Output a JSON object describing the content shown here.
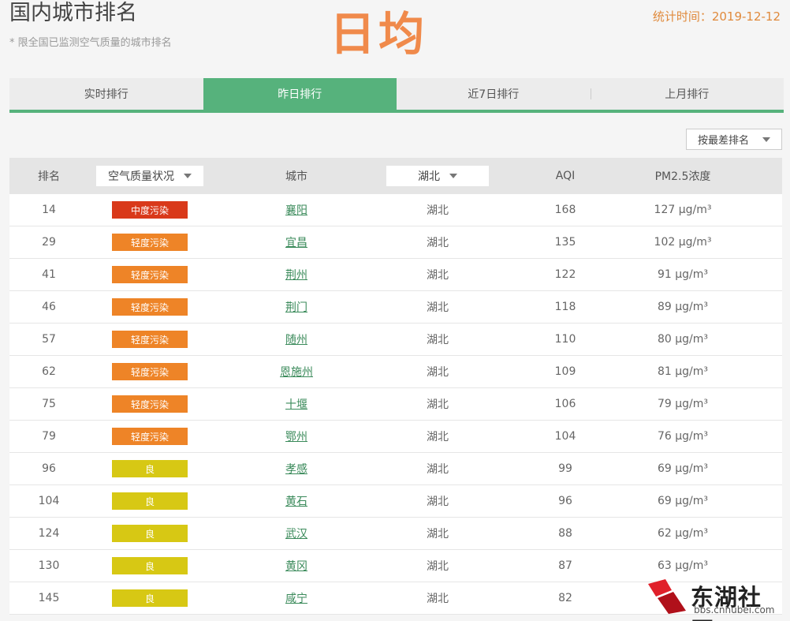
{
  "header": {
    "title": "国内城市排名",
    "subtitle": "* 限全国已监测空气质量的城市排名",
    "overlay_text": "日均",
    "stat_time": "统计时间：2019-12-12"
  },
  "tabs": [
    {
      "label": "实时排行",
      "active": false
    },
    {
      "label": "昨日排行",
      "active": true
    },
    {
      "label": "近7日排行",
      "active": false
    },
    {
      "label": "上月排行",
      "active": false
    }
  ],
  "sort": {
    "label": "按最差排名"
  },
  "table": {
    "headers": {
      "rank": "排名",
      "status": "空气质量状况",
      "city": "城市",
      "province": "湖北",
      "aqi": "AQI",
      "pm": "PM2.5浓度"
    },
    "status_colors": {
      "中度污染": "#d9391a",
      "轻度污染": "#ee8427",
      "良": "#d7c814"
    },
    "rows": [
      {
        "rank": "14",
        "status": "中度污染",
        "city": "襄阳",
        "province": "湖北",
        "aqi": "168",
        "pm": "127 μg/m³"
      },
      {
        "rank": "29",
        "status": "轻度污染",
        "city": "宜昌",
        "province": "湖北",
        "aqi": "135",
        "pm": "102 μg/m³"
      },
      {
        "rank": "41",
        "status": "轻度污染",
        "city": "荆州",
        "province": "湖北",
        "aqi": "122",
        "pm": "91 μg/m³"
      },
      {
        "rank": "46",
        "status": "轻度污染",
        "city": "荆门",
        "province": "湖北",
        "aqi": "118",
        "pm": "89 μg/m³"
      },
      {
        "rank": "57",
        "status": "轻度污染",
        "city": "随州",
        "province": "湖北",
        "aqi": "110",
        "pm": "80 μg/m³"
      },
      {
        "rank": "62",
        "status": "轻度污染",
        "city": "恩施州",
        "province": "湖北",
        "aqi": "109",
        "pm": "81 μg/m³"
      },
      {
        "rank": "75",
        "status": "轻度污染",
        "city": "十堰",
        "province": "湖北",
        "aqi": "106",
        "pm": "79 μg/m³"
      },
      {
        "rank": "79",
        "status": "轻度污染",
        "city": "鄂州",
        "province": "湖北",
        "aqi": "104",
        "pm": "76 μg/m³"
      },
      {
        "rank": "96",
        "status": "良",
        "city": "孝感",
        "province": "湖北",
        "aqi": "99",
        "pm": "69 μg/m³"
      },
      {
        "rank": "104",
        "status": "良",
        "city": "黄石",
        "province": "湖北",
        "aqi": "96",
        "pm": "69 μg/m³"
      },
      {
        "rank": "124",
        "status": "良",
        "city": "武汉",
        "province": "湖北",
        "aqi": "88",
        "pm": "62 μg/m³"
      },
      {
        "rank": "130",
        "status": "良",
        "city": "黄冈",
        "province": "湖北",
        "aqi": "87",
        "pm": "63 μg/m³"
      },
      {
        "rank": "145",
        "status": "良",
        "city": "咸宁",
        "province": "湖北",
        "aqi": "82",
        "pm": ""
      }
    ]
  },
  "watermark": {
    "text": "东湖社区",
    "url": "bbs.cnhubei.com",
    "colors": {
      "red": "#e0202a",
      "dark": "#b0101a"
    }
  }
}
